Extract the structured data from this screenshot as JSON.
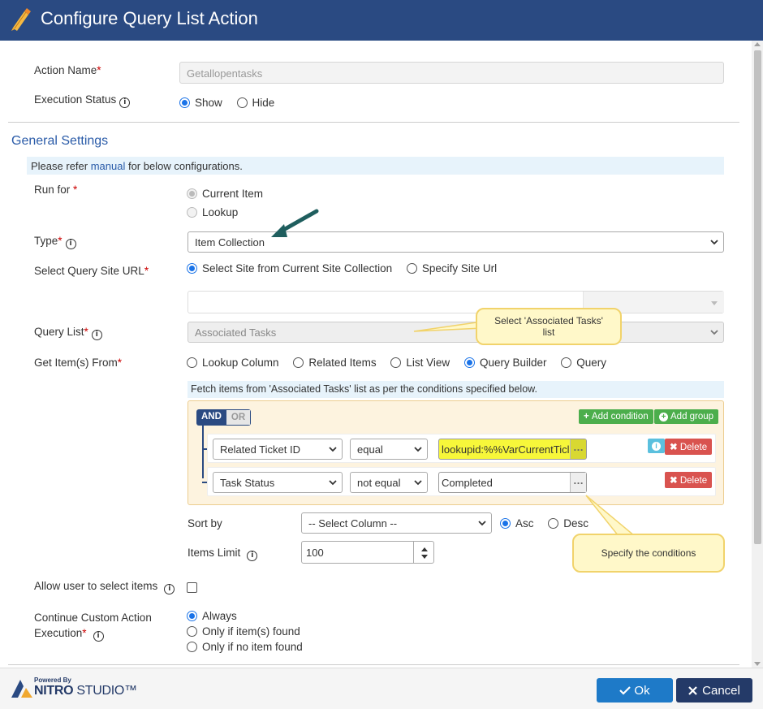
{
  "dialog": {
    "title": "Configure Query List Action"
  },
  "action_name": {
    "label": "Action Name",
    "value": "Getallopentasks"
  },
  "execution_status": {
    "label": "Execution Status",
    "options": [
      "Show",
      "Hide"
    ],
    "selected": "Show"
  },
  "general": {
    "title": "General Settings",
    "note_prefix": "Please refer ",
    "note_link": "manual",
    "note_suffix": " for below configurations."
  },
  "run_for": {
    "label": "Run for",
    "options": [
      "Current Item",
      "Lookup"
    ],
    "selected": "Current Item"
  },
  "type": {
    "label": "Type",
    "value": "Item Collection"
  },
  "site_url": {
    "label": "Select Query Site URL",
    "options": [
      "Select Site from Current Site Collection",
      "Specify Site Url"
    ],
    "selected": "Select Site from Current Site Collection",
    "value": ""
  },
  "query_list": {
    "label": "Query List",
    "value": "Associated Tasks"
  },
  "get_items": {
    "label": "Get Item(s) From",
    "options": [
      "Lookup Column",
      "Related Items",
      "List View",
      "Query Builder",
      "Query"
    ],
    "selected": "Query Builder"
  },
  "fetch_note": "Fetch items from 'Associated Tasks' list as per the conditions specified below.",
  "query_builder": {
    "and_label": "AND",
    "or_label": "OR",
    "add_condition": "Add condition",
    "add_group": "Add group",
    "delete_label": "Delete",
    "rules": [
      {
        "field": "Related Ticket ID",
        "operator": "equal",
        "value": "lookupid:%%VarCurrentTicl"
      },
      {
        "field": "Task Status",
        "operator": "not equal",
        "value": "Completed"
      }
    ]
  },
  "sort_by": {
    "label": "Sort by",
    "value": "-- Select Column --",
    "options": [
      "Asc",
      "Desc"
    ],
    "selected": "Asc"
  },
  "items_limit": {
    "label": "Items Limit",
    "value": "100"
  },
  "allow_select": {
    "label": "Allow user to select items",
    "checked": false
  },
  "continue_exec": {
    "label_line1": "Continue Custom Action",
    "label_line2": "Execution",
    "options": [
      "Always",
      "Only if item(s) found",
      "Only if no item found"
    ],
    "selected": "Always"
  },
  "callouts": {
    "query_list_line1": "Select 'Associated Tasks'",
    "query_list_line2": "list",
    "conditions": "Specify the conditions"
  },
  "footer": {
    "powered_by": "Powered By",
    "brand_bold": "NITRO",
    "brand_light": " STUDIO™",
    "ok": "Ok",
    "cancel": "Cancel"
  },
  "colors": {
    "header": "#2a4a82",
    "accent": "#1a73e8",
    "ok": "#1e7ac8",
    "cancel": "#243a68",
    "highlight": "#f7f73a"
  }
}
